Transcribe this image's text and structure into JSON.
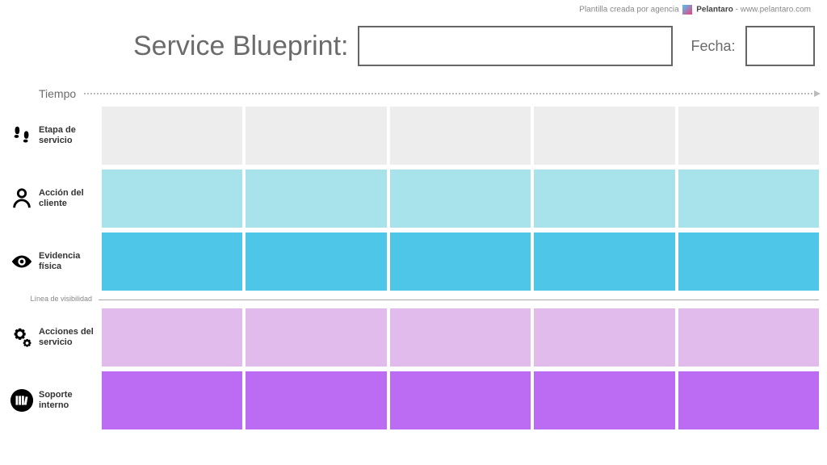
{
  "attribution": {
    "prefix": "Plantilla creada por agencia",
    "brand": "Pelantaro",
    "url": "- www.pelantaro.com"
  },
  "header": {
    "title": "Service Blueprint:",
    "fecha_label": "Fecha:",
    "title_value": "",
    "fecha_value": ""
  },
  "tiempo": {
    "label": "Tiempo"
  },
  "visibility": {
    "label": "Línea de visibilidad"
  },
  "rows": {
    "etapa": {
      "label": "Etapa de servicio"
    },
    "accion": {
      "label": "Acción del cliente"
    },
    "evidencia": {
      "label": "Evidencia física"
    },
    "servicio": {
      "label": "Acciones del servicio"
    },
    "soporte": {
      "label": "Soporte interno"
    }
  },
  "columns": 5
}
